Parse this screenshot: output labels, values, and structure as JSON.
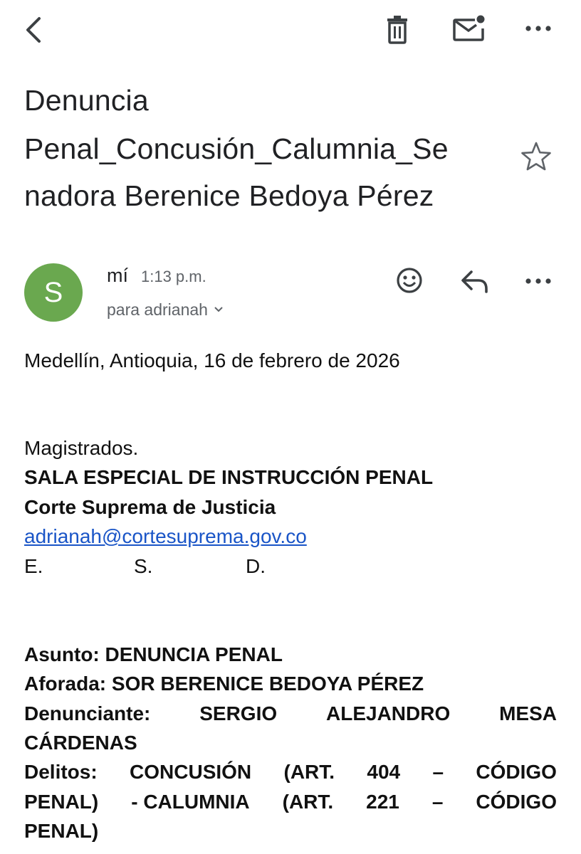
{
  "toolbar": {
    "back_icon": "chevron-left-icon",
    "delete_icon": "trash-icon",
    "unread_icon": "mail-unread-icon",
    "more_icon": "more-horizontal-icon"
  },
  "subject": {
    "lines": [
      "Denuncia",
      "Penal_Concusión_Calumnia_Se",
      "nadora Berenice Bedoya Pérez"
    ],
    "star_icon": "star-outline-icon"
  },
  "message": {
    "avatar_letter": "S",
    "avatar_color": "#6aa84f",
    "sender": "mí",
    "time": "1:13 p.m.",
    "recipient": "para adrianah",
    "actions": {
      "emoji_icon": "emoji-icon",
      "reply_icon": "reply-icon",
      "more_icon": "more-horizontal-icon"
    }
  },
  "body": {
    "date_line": "Medellín, Antioquia, 16 de febrero de 2026",
    "salutation": "Magistrados.",
    "sala": "SALA ESPECIAL DE INSTRUCCIÓN PENAL",
    "corte": "Corte Suprema de Justicia",
    "email": "adrianah@cortesuprema.gov.co",
    "esd": [
      "E.",
      "S.",
      "D."
    ],
    "asunto": "Asunto: DENUNCIA PENAL",
    "aforada": "Aforada: SOR BERENICE BEDOYA PÉREZ",
    "denunciante_line1": [
      "Denunciante:",
      "SERGIO",
      "ALEJANDRO",
      "MESA"
    ],
    "denunciante_line2": "CÁRDENAS",
    "delitos_line1": [
      "Delitos:",
      "CONCUSIÓN",
      "(ART.",
      "404",
      "–",
      "CÓDIGO"
    ],
    "delitos_line2": [
      "PENAL)",
      "- CALUMNIA",
      "(ART.",
      "221",
      "–",
      "CÓDIGO"
    ],
    "delitos_line3": "PENAL)"
  }
}
